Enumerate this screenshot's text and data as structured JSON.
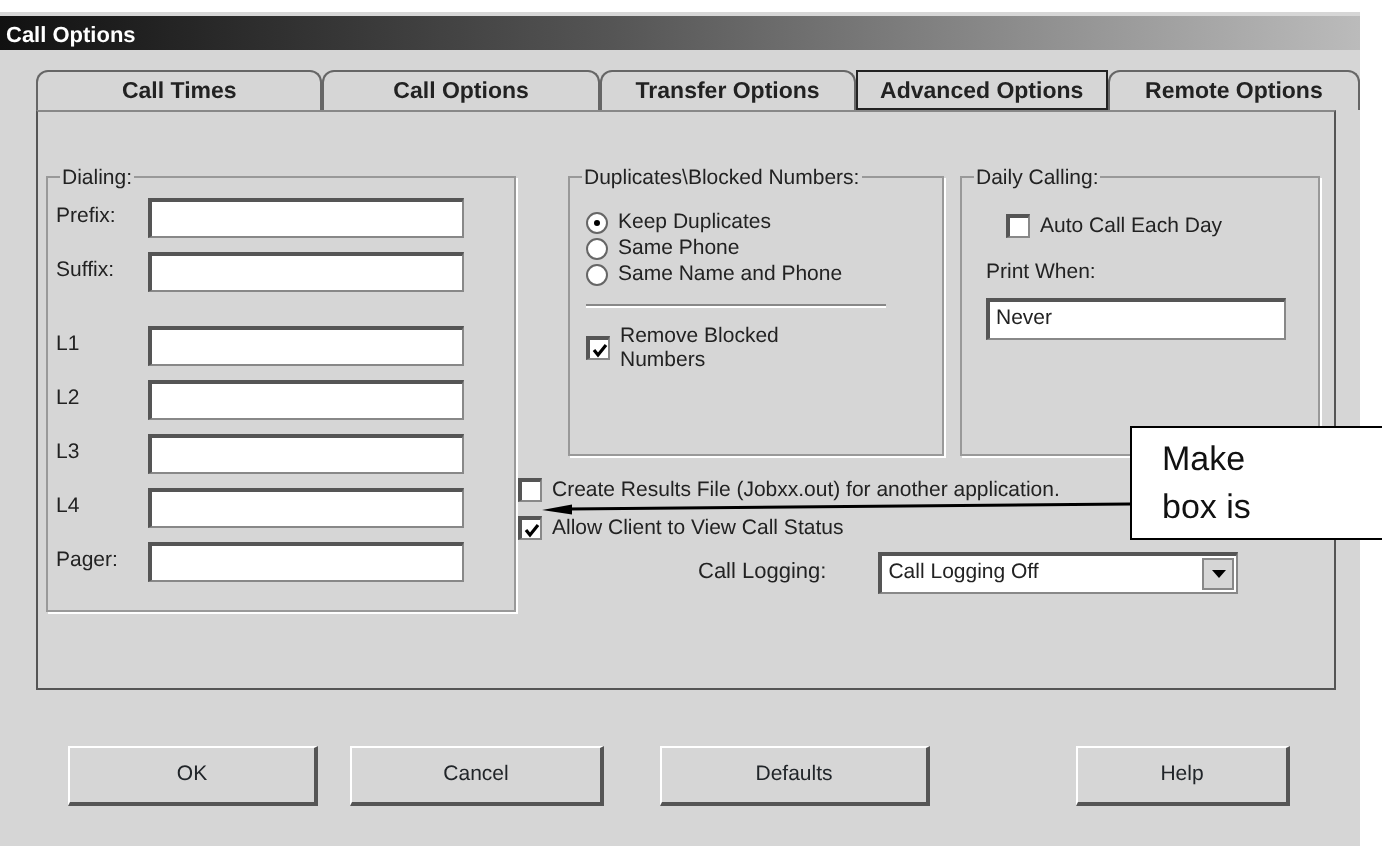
{
  "window": {
    "title": "Call Options"
  },
  "tabs": [
    {
      "label": "Call Times",
      "selected": false
    },
    {
      "label": "Call Options",
      "selected": false
    },
    {
      "label": "Transfer Options",
      "selected": false
    },
    {
      "label": "Advanced Options",
      "selected": true
    },
    {
      "label": "Remote Options",
      "selected": false
    }
  ],
  "dialing": {
    "title": "Dialing:",
    "fields": [
      {
        "label": "Prefix:"
      },
      {
        "label": "Suffix:"
      },
      {
        "label": "L1"
      },
      {
        "label": "L2"
      },
      {
        "label": "L3"
      },
      {
        "label": "L4"
      },
      {
        "label": "Pager:"
      }
    ]
  },
  "duplicates": {
    "title": "Duplicates\\Blocked Numbers:",
    "options": [
      {
        "label": "Keep Duplicates",
        "selected": true
      },
      {
        "label": "Same Phone",
        "selected": false
      },
      {
        "label": "Same Name and Phone",
        "selected": false
      }
    ],
    "remove_blocked": {
      "label": "Remove Blocked Numbers",
      "checked": true
    }
  },
  "daily_calling": {
    "title": "Daily Calling:",
    "auto_call": {
      "label": "Auto Call Each Day",
      "checked": false
    },
    "print_when": {
      "label": "Print When:",
      "value": "Never"
    }
  },
  "options": [
    {
      "label": "Create Results File (Jobxx.out) for another application.",
      "checked": false
    },
    {
      "label": "Allow Client to View Call Status",
      "checked": true
    }
  ],
  "call_logging": {
    "label": "Call Logging:",
    "value": "Call Logging Off"
  },
  "buttons": [
    {
      "label": "OK"
    },
    {
      "label": "Cancel"
    },
    {
      "label": "Defaults"
    },
    {
      "label": "Help"
    }
  ],
  "callout": {
    "lines": [
      "Make",
      "box is"
    ]
  }
}
